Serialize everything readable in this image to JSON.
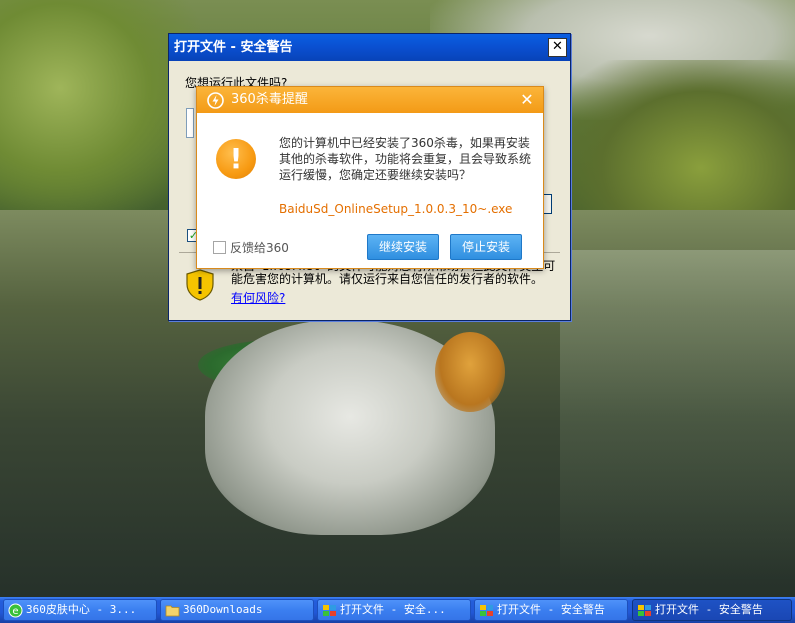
{
  "security_window": {
    "title": "打开文件 - 安全警告",
    "close_glyph": "✕",
    "question": "您想运行此文件吗?",
    "warning_text": "来自 Internet 的文件可能对您有所帮助，但此文件类型可能危害您的计算机。请仅运行来自您信任的发行者的软件。",
    "risk_link": "有何风险?"
  },
  "alert_360": {
    "title": "360杀毒提醒",
    "close_glyph": "✕",
    "icon_glyph": "!",
    "message": "您的计算机中已经安装了360杀毒，如果再安装其他的杀毒软件，功能将会重复，且会导致系统运行缓慢，您确定还要继续安装吗？",
    "filename": "BaiduSd_OnlineSetup_1.0.0.3_10~.exe",
    "feedback_label": "反馈给360",
    "continue_label": "继续安装",
    "stop_label": "停止安装",
    "accent_color": "#f39a16",
    "button_color": "#2f8fe0"
  },
  "taskbar": {
    "items": [
      {
        "label": "360皮肤中心 - 3...",
        "icon": "ie-icon"
      },
      {
        "label": "360Downloads",
        "icon": "folder-icon"
      },
      {
        "label": "打开文件 - 安全...",
        "icon": "security-icon"
      },
      {
        "label": "打开文件 - 安全警告",
        "icon": "security-icon"
      },
      {
        "label": "打开文件 - 安全警告",
        "icon": "security-icon"
      }
    ]
  }
}
